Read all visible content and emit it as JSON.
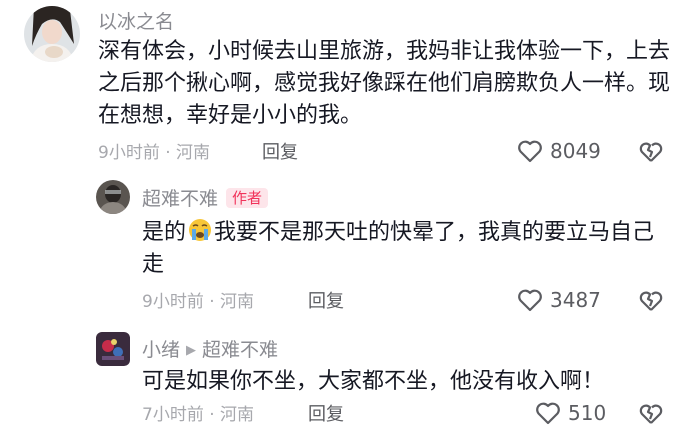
{
  "comments": [
    {
      "username": "以冰之名",
      "text": "深有体会，小时候去山里旅游，我妈非让我体验一下，上去之后那个揪心啊，感觉我好像踩在他们肩膀欺负人一样。现在想想，幸好是小小的我。",
      "meta": "9小时前 · 河南",
      "reply_label": "回复",
      "likes": "8049",
      "icons": [
        "heart-outline-icon",
        "broken-heart-icon"
      ]
    },
    {
      "username": "超难不难",
      "badge": "作者",
      "text_before_emoji": "是的",
      "emoji": "crying-face-emoji",
      "text_after_emoji": "我要不是那天吐的快晕了，我真的要立马自己走",
      "meta": "9小时前 · 河南",
      "reply_label": "回复",
      "likes": "3487",
      "icons": [
        "heart-outline-icon",
        "broken-heart-icon"
      ]
    },
    {
      "username": "小绪",
      "reply_to": "超难不难",
      "text": "可是如果你不坐，大家都不坐，他没有收入啊！",
      "meta": "7小时前 · 河南",
      "reply_label": "回复",
      "likes": "510",
      "icons": [
        "heart-outline-icon",
        "broken-heart-icon"
      ]
    }
  ],
  "colors": {
    "text": "#161823",
    "secondary": "#8a8b91",
    "meta": "#a7a8ad",
    "badge_bg": "#fde5ea",
    "badge_text": "#f1335a"
  }
}
